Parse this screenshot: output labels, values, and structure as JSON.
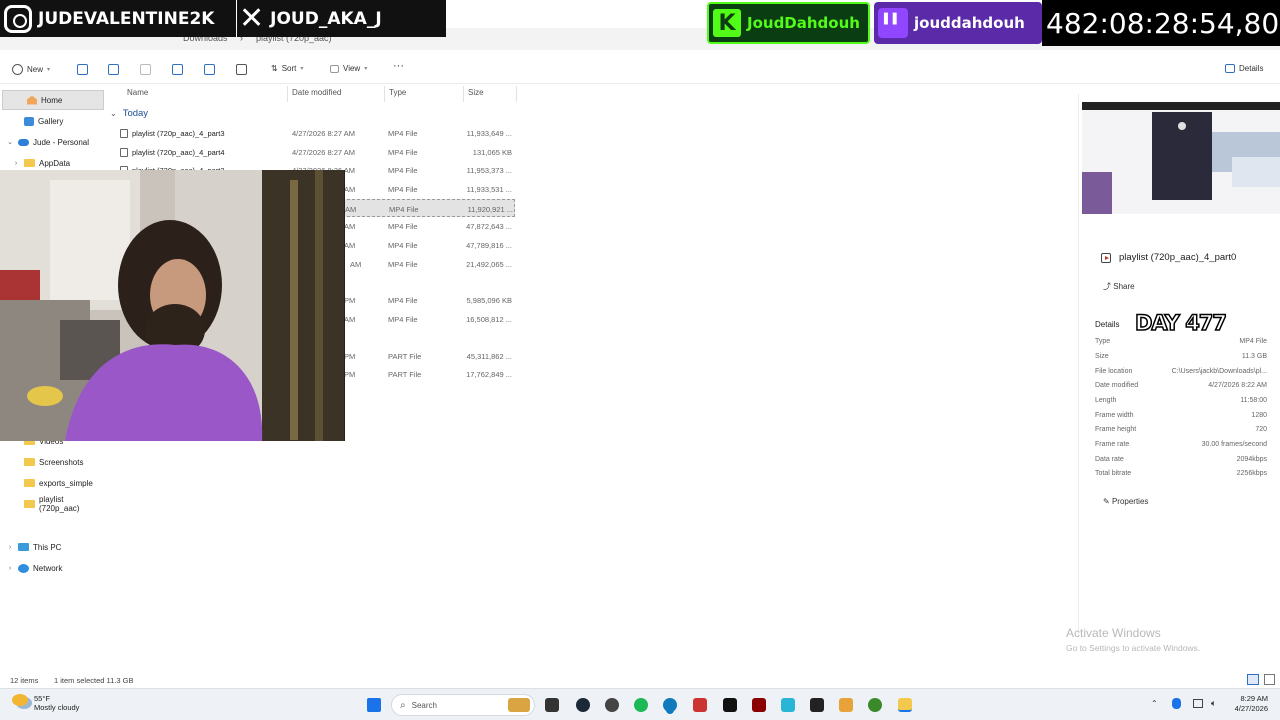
{
  "overlay": {
    "instagram_handle": "JUDEVALENTINE2K",
    "x_handle": "JOUD_AKA_J",
    "kick_handle": "JoudDahdouh",
    "twitch_handle": "jouddahdouh",
    "timer": "482:08:28:54,80",
    "day_badge": "DAY 477",
    "colors": {
      "kick": "#53fc18",
      "twitch": "#9146ff"
    }
  },
  "explorer": {
    "address": {
      "segment1": "Downloads",
      "segment2": "playlist (720p_aac)"
    },
    "toolbar": {
      "new_label": "New",
      "sort_label": "Sort",
      "view_label": "View",
      "more_label": "···",
      "details_label": "Details"
    },
    "sidebar": {
      "home": "Home",
      "gallery": "Gallery",
      "personal": "Jude - Personal",
      "appdata": "AppData",
      "videos": "Videos",
      "screenshots": "Screenshots",
      "exports": "exports_simple",
      "playlist": "playlist (720p_aac)",
      "this_pc": "This PC",
      "network": "Network"
    },
    "columns": {
      "name": "Name",
      "date": "Date modified",
      "type": "Type",
      "size": "Size"
    },
    "group_label": "Today",
    "rows": [
      {
        "name": "playlist (720p_aac)_4_part3",
        "date": "4/27/2026 8:27 AM",
        "type": "MP4 File",
        "size": "11,933,649 ..."
      },
      {
        "name": "playlist (720p_aac)_4_part4",
        "date": "4/27/2026 8:27 AM",
        "type": "MP4 File",
        "size": "131,065 KB"
      },
      {
        "name": "playlist (720p_aac)_4_part2",
        "date": "4/27/2026 8:26 AM",
        "type": "MP4 File",
        "size": "11,953,373 ..."
      },
      {
        "name": "",
        "date": "AM",
        "type": "MP4 File",
        "size": "11,933,531 ..."
      },
      {
        "name": "",
        "date": "AM",
        "type": "MP4 File",
        "size": "11,920,921 ..."
      },
      {
        "name": "",
        "date": "AM",
        "type": "MP4 File",
        "size": "47,872,643 ..."
      },
      {
        "name": "",
        "date": "AM",
        "type": "MP4 File",
        "size": "47,789,816 ..."
      },
      {
        "name": "",
        "date": "AM",
        "type": "MP4 File",
        "size": "21,492,065 ..."
      },
      {
        "name": "",
        "date": "PM",
        "type": "MP4 File",
        "size": "5,985,096 KB"
      },
      {
        "name": "",
        "date": "AM",
        "type": "MP4 File",
        "size": "16,508,812 ..."
      },
      {
        "name": "",
        "date": "PM",
        "type": "PART File",
        "size": "45,311,862 ..."
      },
      {
        "name": "",
        "date": "PM",
        "type": "PART File",
        "size": "17,762,849 ..."
      }
    ],
    "status": {
      "count": "12 items",
      "selected": "1 item selected  11.3 GB"
    }
  },
  "details": {
    "filename": "playlist (720p_aac)_4_part0",
    "share_label": "Share",
    "section_label": "Details",
    "properties": [
      {
        "label": "Type",
        "value": "MP4 File"
      },
      {
        "label": "Size",
        "value": "11.3 GB"
      },
      {
        "label": "File location",
        "value": "C:\\Users\\jackb\\Downloads\\pl..."
      },
      {
        "label": "Date modified",
        "value": "4/27/2026 8:22 AM"
      },
      {
        "label": "Length",
        "value": "11:58:00"
      },
      {
        "label": "Frame width",
        "value": "1280"
      },
      {
        "label": "Frame height",
        "value": "720"
      },
      {
        "label": "Frame rate",
        "value": "30.00 frames/second"
      },
      {
        "label": "Data rate",
        "value": "2094kbps"
      },
      {
        "label": "Total bitrate",
        "value": "2256kbps"
      }
    ],
    "properties_button": "Properties"
  },
  "watermark": {
    "line1": "Activate Windows",
    "line2": "Go to Settings to activate Windows."
  },
  "taskbar": {
    "weather_temp": "55°F",
    "weather_desc": "Mostly cloudy",
    "search_placeholder": "Search",
    "time": "8:29 AM",
    "date": "4/27/2026"
  }
}
